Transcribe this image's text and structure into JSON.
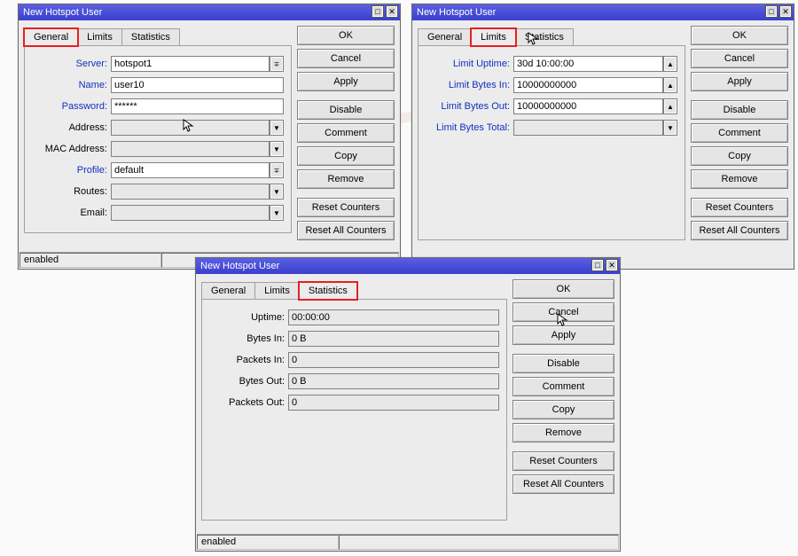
{
  "win1": {
    "title": "New Hotspot User",
    "tabs": {
      "general": "General",
      "limits": "Limits",
      "statistics": "Statistics"
    },
    "fields": {
      "server_label": "Server:",
      "server_value": "hotspot1",
      "name_label": "Name:",
      "name_value": "user10",
      "password_label": "Password:",
      "password_value": "******",
      "address_label": "Address:",
      "address_value": "",
      "mac_label": "MAC Address:",
      "mac_value": "",
      "profile_label": "Profile:",
      "profile_value": "default",
      "routes_label": "Routes:",
      "routes_value": "",
      "email_label": "Email:",
      "email_value": ""
    },
    "status": "enabled"
  },
  "win2": {
    "title": "New Hotspot User",
    "tabs": {
      "general": "General",
      "limits": "Limits",
      "statistics": "Statistics"
    },
    "fields": {
      "uptime_label": "Limit Uptime:",
      "uptime_value": "30d 10:00:00",
      "bytesin_label": "Limit Bytes In:",
      "bytesin_value": "10000000000",
      "bytesout_label": "Limit Bytes Out:",
      "bytesout_value": "10000000000",
      "bytestotal_label": "Limit Bytes Total:",
      "bytestotal_value": ""
    }
  },
  "win3": {
    "title": "New Hotspot User",
    "tabs": {
      "general": "General",
      "limits": "Limits",
      "statistics": "Statistics"
    },
    "fields": {
      "uptime_label": "Uptime:",
      "uptime_value": "00:00:00",
      "bytesin_label": "Bytes In:",
      "bytesin_value": "0 B",
      "packetsin_label": "Packets In:",
      "packetsin_value": "0",
      "bytesout_label": "Bytes Out:",
      "bytesout_value": "0 B",
      "packetsout_label": "Packets Out:",
      "packetsout_value": "0"
    },
    "status": "enabled"
  },
  "buttons": {
    "ok": "OK",
    "cancel": "Cancel",
    "apply": "Apply",
    "disable": "Disable",
    "comment": "Comment",
    "copy": "Copy",
    "remove": "Remove",
    "reset_counters": "Reset Counters",
    "reset_all_counters": "Reset All Counters"
  },
  "icons": {
    "tri_down": "▼",
    "tri_up": "▲",
    "dd_combo": "∓"
  }
}
